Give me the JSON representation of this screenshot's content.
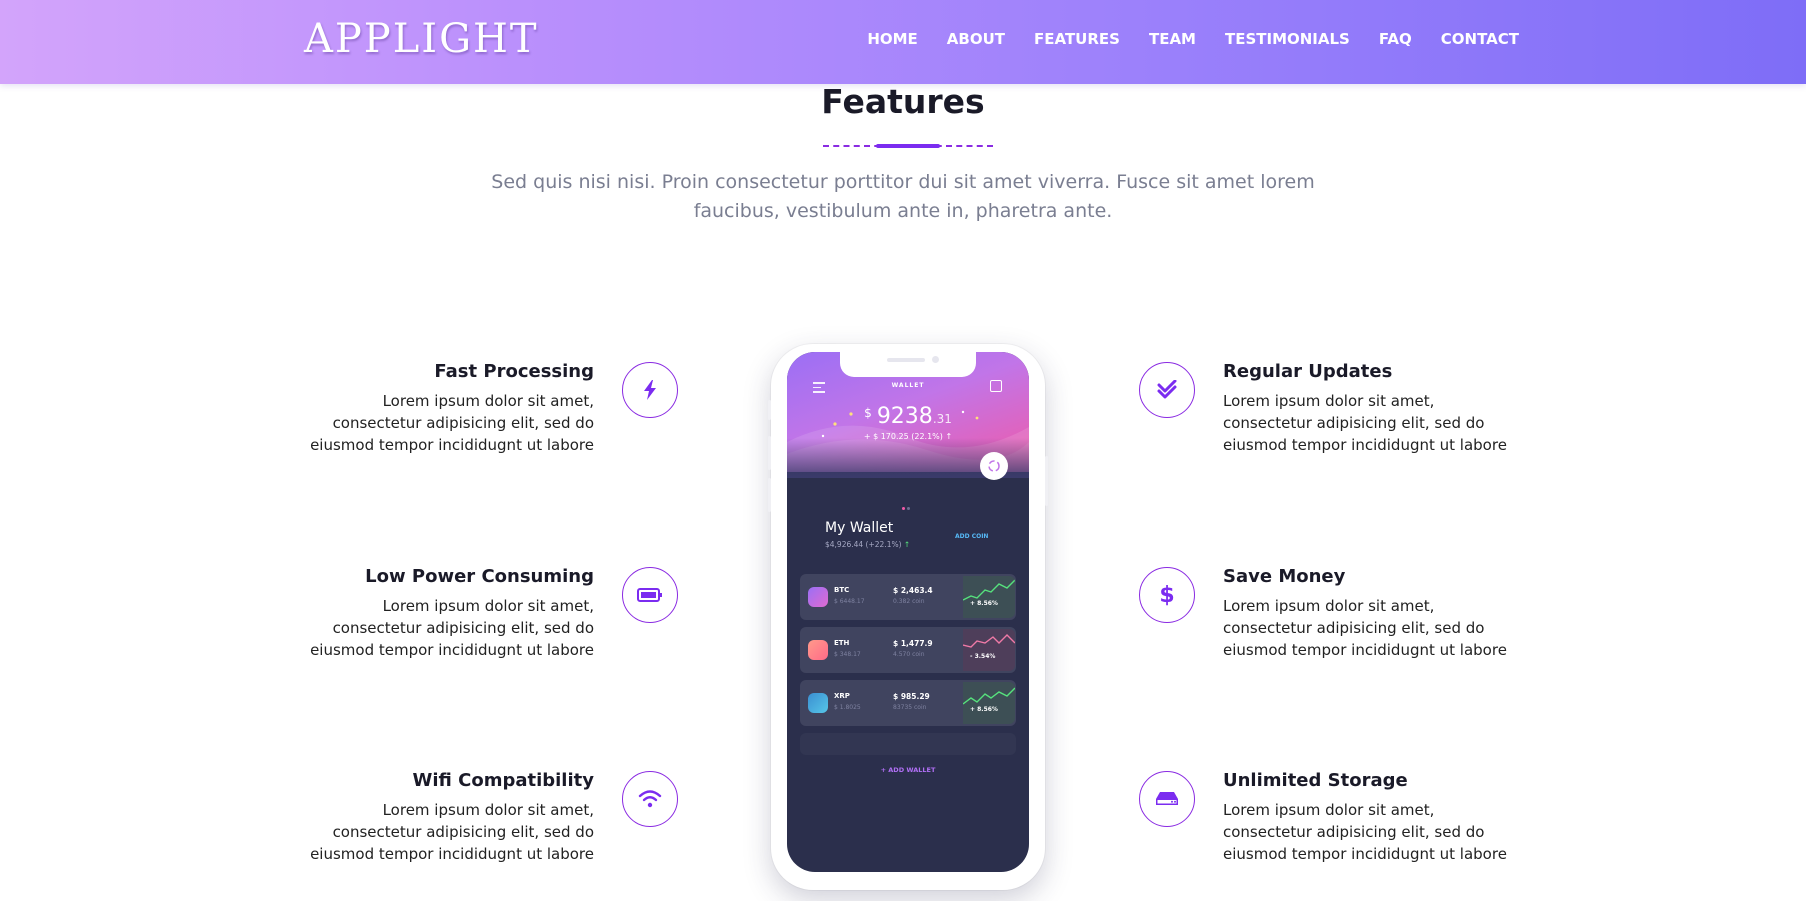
{
  "header": {
    "logo": "APPLIGHT",
    "nav": [
      "HOME",
      "ABOUT",
      "FEATURES",
      "TEAM",
      "TESTIMONIALS",
      "FAQ",
      "CONTACT"
    ]
  },
  "section": {
    "title": "Features",
    "subtitle": "Sed quis nisi nisi. Proin consectetur porttitor dui sit amet viverra. Fusce sit amet lorem faucibus, vestibulum ante in, pharetra ante."
  },
  "features": {
    "left": [
      {
        "title": "Fast Processing",
        "text": "Lorem ipsum dolor sit amet, consectetur adipisicing elit, sed do eiusmod tempor incididugnt ut labore",
        "icon": "bolt-icon"
      },
      {
        "title": "Low Power Consuming",
        "text": "Lorem ipsum dolor sit amet, consectetur adipisicing elit, sed do eiusmod tempor incididugnt ut labore",
        "icon": "battery-icon"
      },
      {
        "title": "Wifi Compatibility",
        "text": "Lorem ipsum dolor sit amet, consectetur adipisicing elit, sed do eiusmod tempor incididugnt ut labore",
        "icon": "wifi-icon"
      }
    ],
    "right": [
      {
        "title": "Regular Updates",
        "text": "Lorem ipsum dolor sit amet, consectetur adipisicing elit, sed do eiusmod tempor incididugnt ut labore",
        "icon": "double-check-icon"
      },
      {
        "title": "Save Money",
        "text": "Lorem ipsum dolor sit amet, consectetur adipisicing elit, sed do eiusmod tempor incididugnt ut labore",
        "icon": "dollar-icon"
      },
      {
        "title": "Unlimited Storage",
        "text": "Lorem ipsum dolor sit amet, consectetur adipisicing elit, sed do eiusmod tempor incididugnt ut labore",
        "icon": "hard-drive-icon"
      }
    ]
  },
  "phone": {
    "screen_title": "WALLET",
    "balance_currency": "$",
    "balance_main": "9238",
    "balance_cents": ".31",
    "balance_change": "+ $ 170.25 (22.1%)",
    "wallet_heading": "My Wallet",
    "wallet_sub": "$4,926.44 (+22.1%)",
    "add_coin": "ADD COIN",
    "coins": [
      {
        "name": "BTC",
        "sub": "$ 6448.17",
        "value": "$ 2,463.4",
        "amount": "0.382 coin",
        "pct": "+ 8.56%"
      },
      {
        "name": "ETH",
        "sub": "$ 348.17",
        "value": "$ 1,477.9",
        "amount": "4.570 coin",
        "pct": "- 3.54%"
      },
      {
        "name": "XRP",
        "sub": "$ 1.8025",
        "value": "$ 985.29",
        "amount": "83735 coin",
        "pct": "+ 8.56%"
      }
    ],
    "add_wallet": "+ ADD WALLET"
  },
  "colors": {
    "accent": "#8a2be2",
    "header_start": "#d3a4fb",
    "header_end": "#7e6df7"
  }
}
